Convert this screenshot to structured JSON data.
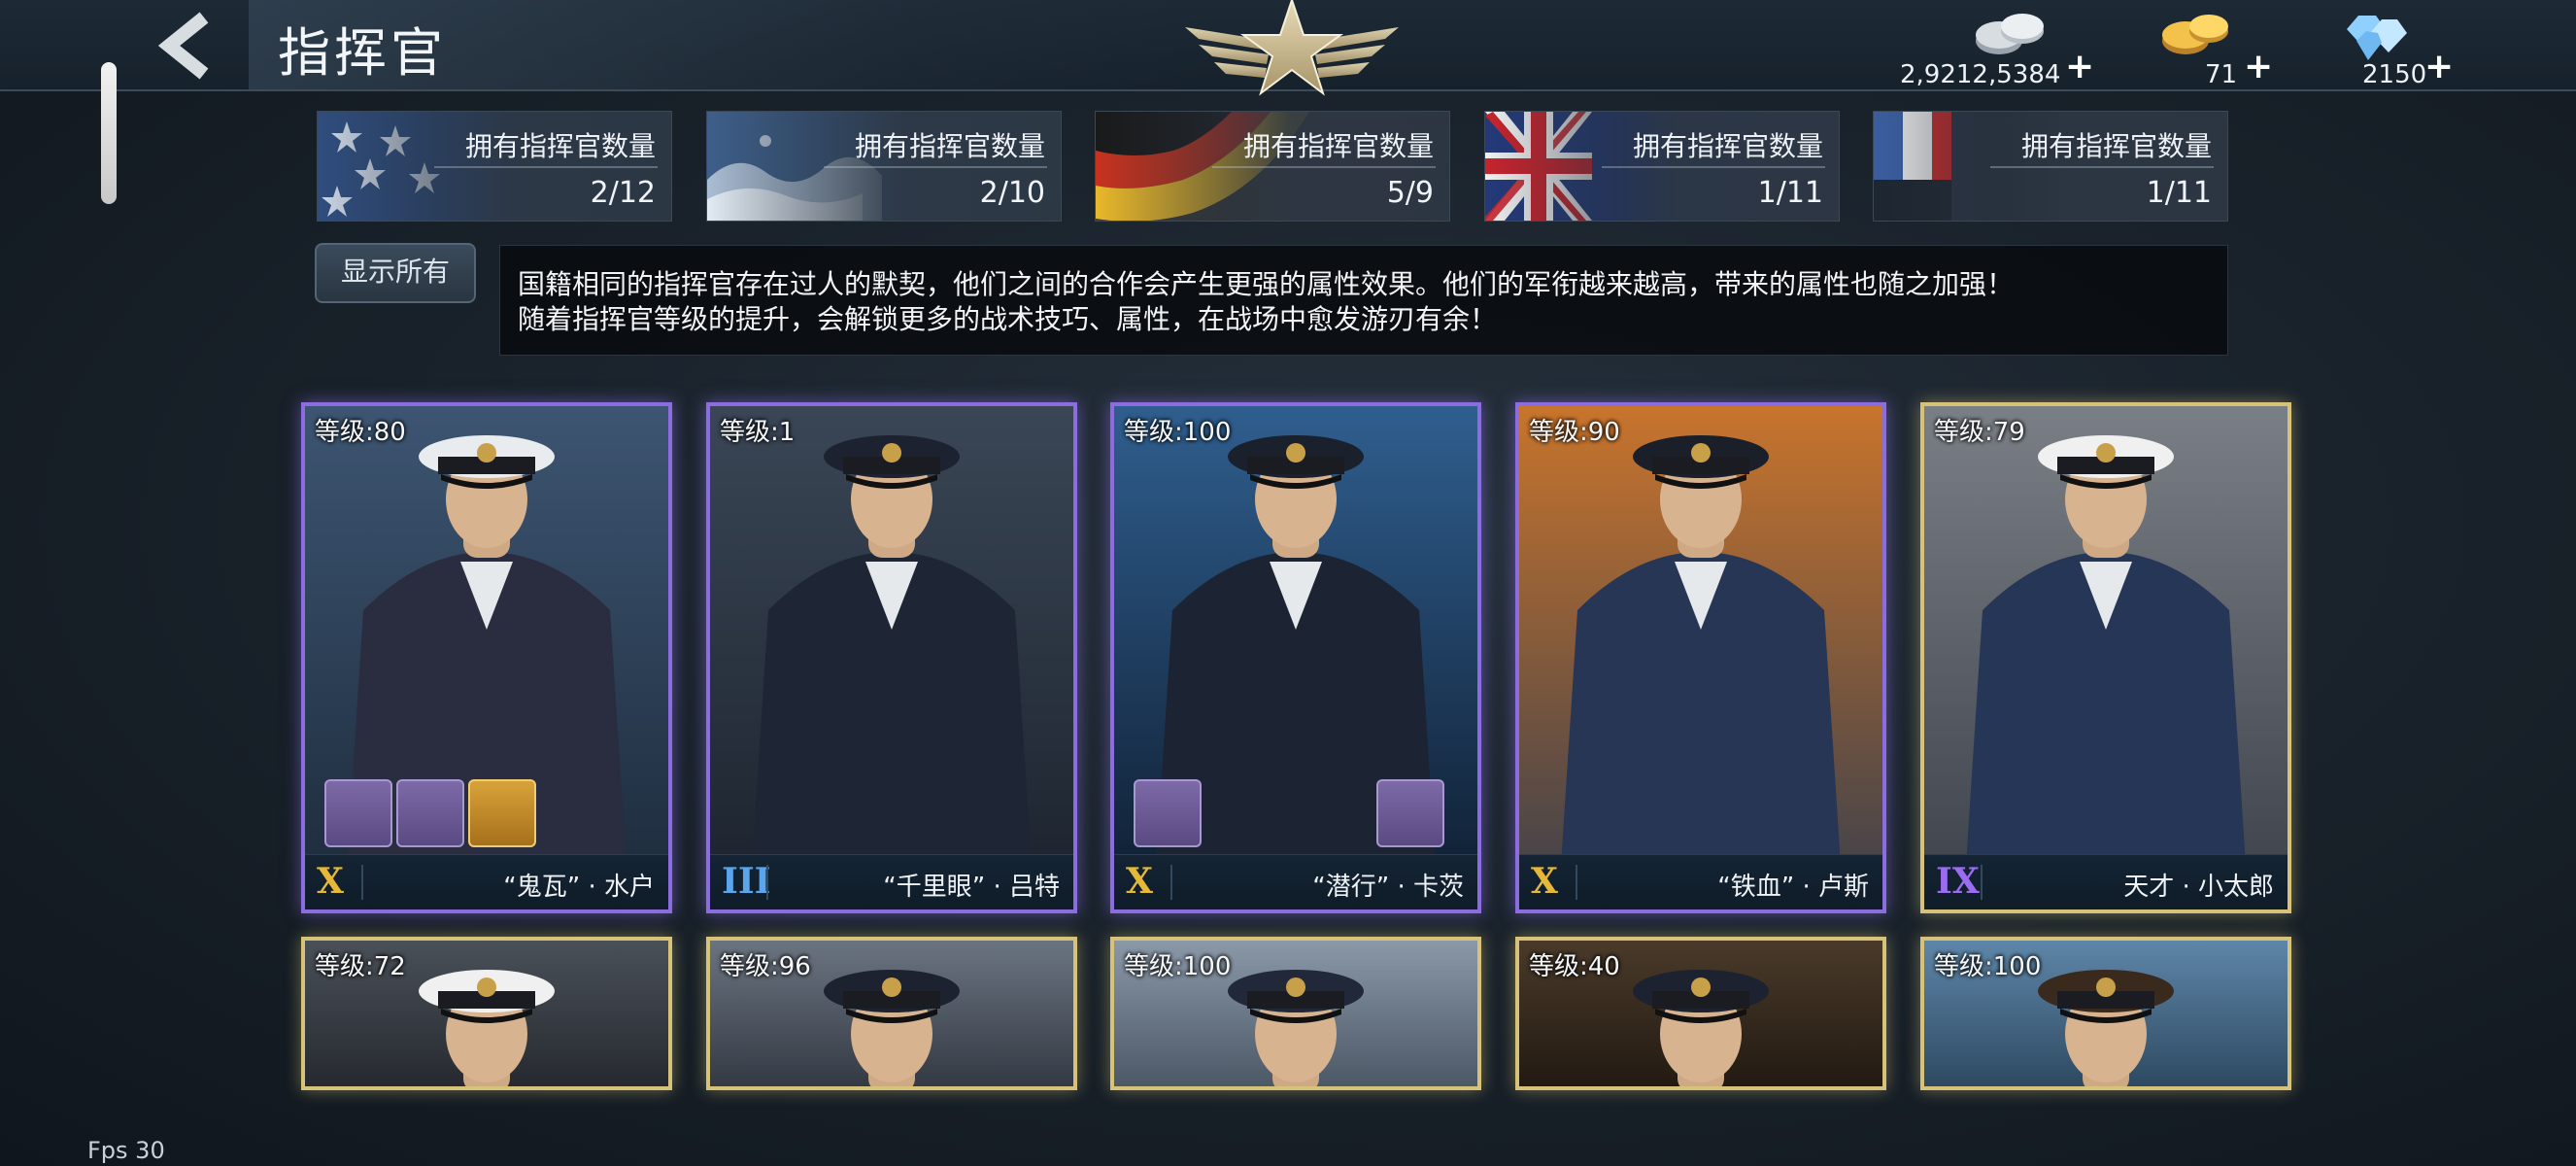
{
  "header": {
    "title": "指挥官",
    "back_icon": "back-arrow-icon",
    "emblem_icon": "star-wings-emblem-icon"
  },
  "resources": [
    {
      "name": "silver",
      "icon": "silver-coins-icon",
      "value": "2,9212,5384",
      "plus": "+"
    },
    {
      "name": "gold",
      "icon": "gold-coins-icon",
      "value": "71",
      "plus": "+"
    },
    {
      "name": "diamond",
      "icon": "diamonds-icon",
      "value": "2150",
      "plus": "+"
    }
  ],
  "nations": [
    {
      "flag": "usa-flag",
      "label": "拥有指挥官数量",
      "count": "2/12"
    },
    {
      "flag": "japan-flag",
      "label": "拥有指挥官数量",
      "count": "2/10"
    },
    {
      "flag": "germany-flag",
      "label": "拥有指挥官数量",
      "count": "5/9"
    },
    {
      "flag": "uk-flag",
      "label": "拥有指挥官数量",
      "count": "1/11"
    },
    {
      "flag": "other-flag",
      "label": "拥有指挥官数量",
      "count": "1/11"
    }
  ],
  "filter": {
    "show_all_label": "显示所有"
  },
  "description": {
    "line1": "国籍相同的指挥官存在过人的默契，他们之间的合作会产生更强的属性效果。他们的军衔越来越高，带来的属性也随之加强！",
    "line2": "随着指挥官等级的提升，会解锁更多的战术技巧、属性，在战场中愈发游刃有余！"
  },
  "commanders_row1": [
    {
      "level": "等级:80",
      "rank": "X",
      "name": "“鬼瓦” · 水户",
      "frame": "purple",
      "rank_color": "#e5b838",
      "uniform": "#2a2d3f",
      "cap": "#e9ecef",
      "bg1": "#3d5572",
      "bg2": "#1c2a3a",
      "skills": [
        "medal-icon",
        "whip-icon",
        "armor-icon"
      ]
    },
    {
      "level": "等级:1",
      "rank": "III",
      "name": "“千里眼” · 吕特",
      "frame": "purple",
      "rank_color": "#5aa6ec",
      "uniform": "#1e2636",
      "cap": "#1c2230",
      "bg1": "#3a4656",
      "bg2": "#1b222c",
      "skills": []
    },
    {
      "level": "等级:100",
      "rank": "X",
      "name": "“潜行” · 卡茨",
      "frame": "purple",
      "rank_color": "#e5b838",
      "uniform": "#1c2434",
      "cap": "#1a202c",
      "bg1": "#2f5e8e",
      "bg2": "#0e1c2e",
      "skills": [
        "telescope-icon",
        "pipe-icon"
      ]
    },
    {
      "level": "等级:90",
      "rank": "X",
      "name": "“铁血” · 卢斯",
      "frame": "purple",
      "rank_color": "#e5b838",
      "uniform": "#283656",
      "cap": "#1a1f2a",
      "bg1": "#c8742c",
      "bg2": "#3a3f4c",
      "skills": []
    },
    {
      "level": "等级:79",
      "rank": "IX",
      "name": "天才 · 小太郎",
      "frame": "gold",
      "rank_color": "#9a6cf0",
      "uniform": "#263656",
      "cap": "#f0f0f0",
      "bg1": "#7a7f86",
      "bg2": "#3c4048",
      "skills": []
    }
  ],
  "commanders_row2": [
    {
      "level": "等级:72",
      "frame": "gold",
      "uniform": "#2a2d3f",
      "cap": "#f0f0f0",
      "bg1": "#4a5058",
      "bg2": "#262a30"
    },
    {
      "level": "等级:96",
      "frame": "gold",
      "uniform": "#1e2636",
      "cap": "#1c2230",
      "bg1": "#6a7480",
      "bg2": "#343a44"
    },
    {
      "level": "等级:100",
      "frame": "gold",
      "uniform": "#1e2636",
      "cap": "#20283a",
      "bg1": "#8a98a8",
      "bg2": "#4c5866"
    },
    {
      "level": "等级:40",
      "frame": "gold",
      "uniform": "#1e2636",
      "cap": "#1c2230",
      "bg1": "#4a3a2a",
      "bg2": "#221a12"
    },
    {
      "level": "等级:100",
      "frame": "gold",
      "uniform": "#3a4a5e",
      "cap": "#3a2a1e",
      "bg1": "#5e86a8",
      "bg2": "#2e4a62"
    }
  ],
  "footer": {
    "fps": "Fps 30"
  }
}
